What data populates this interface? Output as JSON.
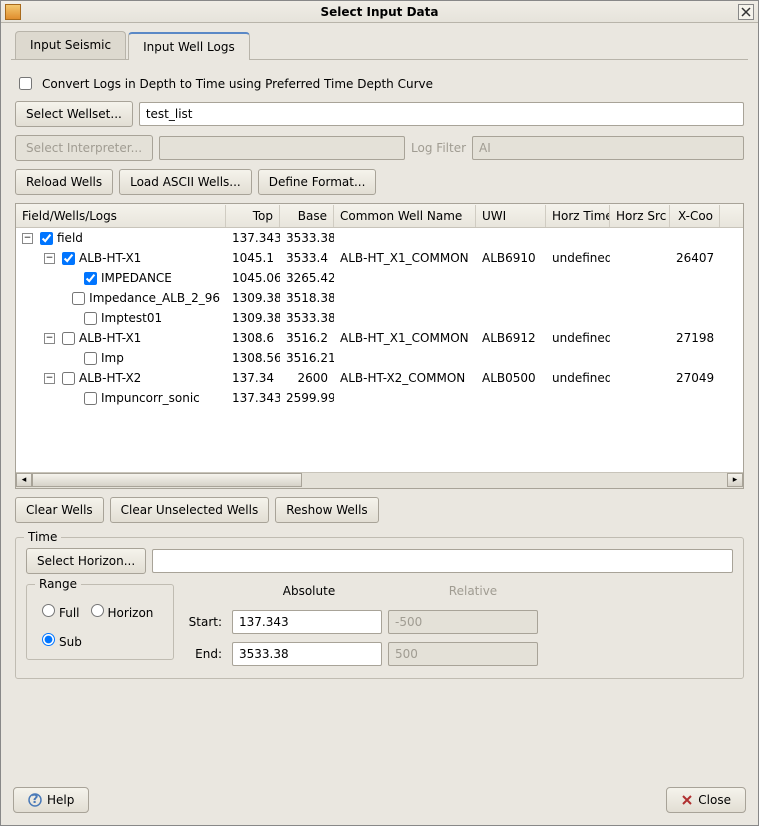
{
  "window": {
    "title": "Select Input Data"
  },
  "tabs": {
    "seismic": "Input Seismic",
    "well_logs": "Input Well Logs"
  },
  "convert_checkbox": {
    "label": "Convert Logs in Depth to Time using Preferred Time Depth Curve",
    "checked": false
  },
  "wellset": {
    "button": "Select Wellset...",
    "value": "test_list"
  },
  "interpreter": {
    "button": "Select Interpreter...",
    "value": ""
  },
  "log_filter": {
    "label": "Log Filter",
    "value": "AI"
  },
  "buttons": {
    "reload": "Reload Wells",
    "load_ascii": "Load ASCII Wells...",
    "define_format": "Define Format..."
  },
  "tree": {
    "headers": {
      "fwl": "Field/Wells/Logs",
      "top": "Top",
      "base": "Base",
      "cwn": "Common Well Name",
      "uwi": "UWI",
      "ht": "Horz Time",
      "hs": "Horz Src",
      "xc": "X-Coo"
    },
    "rows": [
      {
        "indent": 0,
        "exp": "-",
        "checked": true,
        "label": "field",
        "top": "137.343",
        "base": "3533.38"
      },
      {
        "indent": 1,
        "exp": "-",
        "checked": true,
        "label": "ALB-HT-X1",
        "top": "1045.1",
        "base": "3533.4",
        "cwn": "ALB-HT_X1_COMMON",
        "uwi": "ALB6910",
        "ht": "undefined",
        "xc": "26407"
      },
      {
        "indent": 2,
        "checked": true,
        "label": "IMPEDANCE",
        "top": "1045.06",
        "base": "3265.42"
      },
      {
        "indent": 2,
        "checked": false,
        "label": "Impedance_ALB_2_96",
        "top": "1309.38",
        "base": "3518.38"
      },
      {
        "indent": 2,
        "checked": false,
        "label": "Imptest01",
        "top": "1309.38",
        "base": "3533.38"
      },
      {
        "indent": 1,
        "exp": "-",
        "checked": false,
        "label": "ALB-HT-X1",
        "top": "1308.6",
        "base": "3516.2",
        "cwn": "ALB-HT_X1_COMMON",
        "uwi": "ALB6912",
        "ht": "undefined",
        "xc": "27198"
      },
      {
        "indent": 2,
        "checked": false,
        "label": "Imp",
        "top": "1308.56",
        "base": "3516.21"
      },
      {
        "indent": 1,
        "exp": "-",
        "checked": false,
        "label": "ALB-HT-X2",
        "top": "137.34",
        "base": "2600",
        "cwn": "ALB-HT-X2_COMMON",
        "uwi": "ALB0500",
        "ht": "undefined",
        "xc": "27049"
      },
      {
        "indent": 2,
        "checked": false,
        "label": "Impuncorr_sonic",
        "top": "137.343",
        "base": "2599.99"
      }
    ]
  },
  "well_buttons": {
    "clear": "Clear Wells",
    "clear_unselected": "Clear Unselected Wells",
    "reshow": "Reshow Wells"
  },
  "time": {
    "legend": "Time",
    "select_horizon": "Select Horizon...",
    "horizon_value": "",
    "range_legend": "Range",
    "radios": {
      "full": "Full",
      "horizon": "Horizon",
      "sub": "Sub",
      "selected": "sub"
    },
    "absolute": "Absolute",
    "relative": "Relative",
    "start_label": "Start:",
    "end_label": "End:",
    "start": "137.343",
    "end": "3533.38",
    "rel_start": "-500",
    "rel_end": "500"
  },
  "footer": {
    "help": "Help",
    "close": "Close"
  }
}
